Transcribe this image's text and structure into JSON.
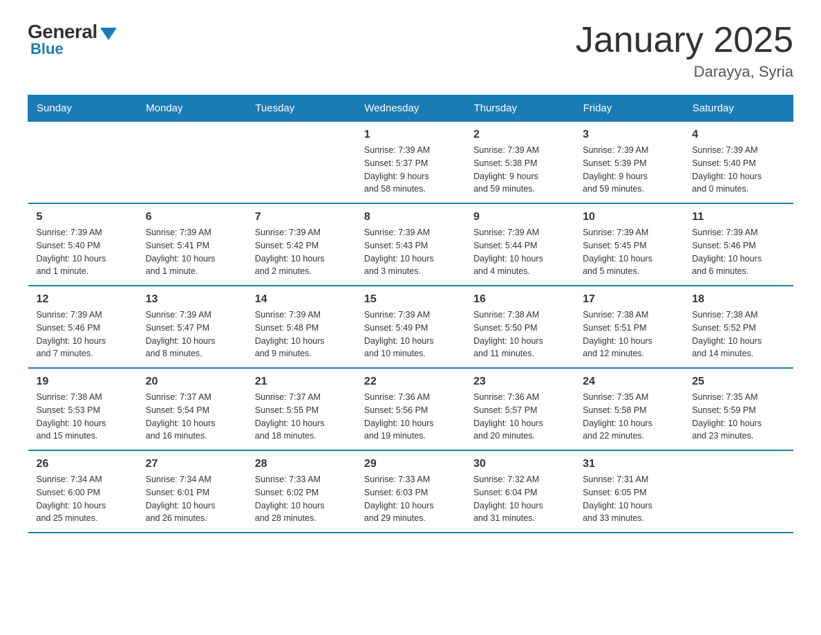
{
  "header": {
    "logo_general": "General",
    "logo_blue": "Blue",
    "title": "January 2025",
    "location": "Darayya, Syria"
  },
  "days_of_week": [
    "Sunday",
    "Monday",
    "Tuesday",
    "Wednesday",
    "Thursday",
    "Friday",
    "Saturday"
  ],
  "weeks": [
    [
      {
        "day": "",
        "info": ""
      },
      {
        "day": "",
        "info": ""
      },
      {
        "day": "",
        "info": ""
      },
      {
        "day": "1",
        "info": "Sunrise: 7:39 AM\nSunset: 5:37 PM\nDaylight: 9 hours\nand 58 minutes."
      },
      {
        "day": "2",
        "info": "Sunrise: 7:39 AM\nSunset: 5:38 PM\nDaylight: 9 hours\nand 59 minutes."
      },
      {
        "day": "3",
        "info": "Sunrise: 7:39 AM\nSunset: 5:39 PM\nDaylight: 9 hours\nand 59 minutes."
      },
      {
        "day": "4",
        "info": "Sunrise: 7:39 AM\nSunset: 5:40 PM\nDaylight: 10 hours\nand 0 minutes."
      }
    ],
    [
      {
        "day": "5",
        "info": "Sunrise: 7:39 AM\nSunset: 5:40 PM\nDaylight: 10 hours\nand 1 minute."
      },
      {
        "day": "6",
        "info": "Sunrise: 7:39 AM\nSunset: 5:41 PM\nDaylight: 10 hours\nand 1 minute."
      },
      {
        "day": "7",
        "info": "Sunrise: 7:39 AM\nSunset: 5:42 PM\nDaylight: 10 hours\nand 2 minutes."
      },
      {
        "day": "8",
        "info": "Sunrise: 7:39 AM\nSunset: 5:43 PM\nDaylight: 10 hours\nand 3 minutes."
      },
      {
        "day": "9",
        "info": "Sunrise: 7:39 AM\nSunset: 5:44 PM\nDaylight: 10 hours\nand 4 minutes."
      },
      {
        "day": "10",
        "info": "Sunrise: 7:39 AM\nSunset: 5:45 PM\nDaylight: 10 hours\nand 5 minutes."
      },
      {
        "day": "11",
        "info": "Sunrise: 7:39 AM\nSunset: 5:46 PM\nDaylight: 10 hours\nand 6 minutes."
      }
    ],
    [
      {
        "day": "12",
        "info": "Sunrise: 7:39 AM\nSunset: 5:46 PM\nDaylight: 10 hours\nand 7 minutes."
      },
      {
        "day": "13",
        "info": "Sunrise: 7:39 AM\nSunset: 5:47 PM\nDaylight: 10 hours\nand 8 minutes."
      },
      {
        "day": "14",
        "info": "Sunrise: 7:39 AM\nSunset: 5:48 PM\nDaylight: 10 hours\nand 9 minutes."
      },
      {
        "day": "15",
        "info": "Sunrise: 7:39 AM\nSunset: 5:49 PM\nDaylight: 10 hours\nand 10 minutes."
      },
      {
        "day": "16",
        "info": "Sunrise: 7:38 AM\nSunset: 5:50 PM\nDaylight: 10 hours\nand 11 minutes."
      },
      {
        "day": "17",
        "info": "Sunrise: 7:38 AM\nSunset: 5:51 PM\nDaylight: 10 hours\nand 12 minutes."
      },
      {
        "day": "18",
        "info": "Sunrise: 7:38 AM\nSunset: 5:52 PM\nDaylight: 10 hours\nand 14 minutes."
      }
    ],
    [
      {
        "day": "19",
        "info": "Sunrise: 7:38 AM\nSunset: 5:53 PM\nDaylight: 10 hours\nand 15 minutes."
      },
      {
        "day": "20",
        "info": "Sunrise: 7:37 AM\nSunset: 5:54 PM\nDaylight: 10 hours\nand 16 minutes."
      },
      {
        "day": "21",
        "info": "Sunrise: 7:37 AM\nSunset: 5:55 PM\nDaylight: 10 hours\nand 18 minutes."
      },
      {
        "day": "22",
        "info": "Sunrise: 7:36 AM\nSunset: 5:56 PM\nDaylight: 10 hours\nand 19 minutes."
      },
      {
        "day": "23",
        "info": "Sunrise: 7:36 AM\nSunset: 5:57 PM\nDaylight: 10 hours\nand 20 minutes."
      },
      {
        "day": "24",
        "info": "Sunrise: 7:35 AM\nSunset: 5:58 PM\nDaylight: 10 hours\nand 22 minutes."
      },
      {
        "day": "25",
        "info": "Sunrise: 7:35 AM\nSunset: 5:59 PM\nDaylight: 10 hours\nand 23 minutes."
      }
    ],
    [
      {
        "day": "26",
        "info": "Sunrise: 7:34 AM\nSunset: 6:00 PM\nDaylight: 10 hours\nand 25 minutes."
      },
      {
        "day": "27",
        "info": "Sunrise: 7:34 AM\nSunset: 6:01 PM\nDaylight: 10 hours\nand 26 minutes."
      },
      {
        "day": "28",
        "info": "Sunrise: 7:33 AM\nSunset: 6:02 PM\nDaylight: 10 hours\nand 28 minutes."
      },
      {
        "day": "29",
        "info": "Sunrise: 7:33 AM\nSunset: 6:03 PM\nDaylight: 10 hours\nand 29 minutes."
      },
      {
        "day": "30",
        "info": "Sunrise: 7:32 AM\nSunset: 6:04 PM\nDaylight: 10 hours\nand 31 minutes."
      },
      {
        "day": "31",
        "info": "Sunrise: 7:31 AM\nSunset: 6:05 PM\nDaylight: 10 hours\nand 33 minutes."
      },
      {
        "day": "",
        "info": ""
      }
    ]
  ]
}
